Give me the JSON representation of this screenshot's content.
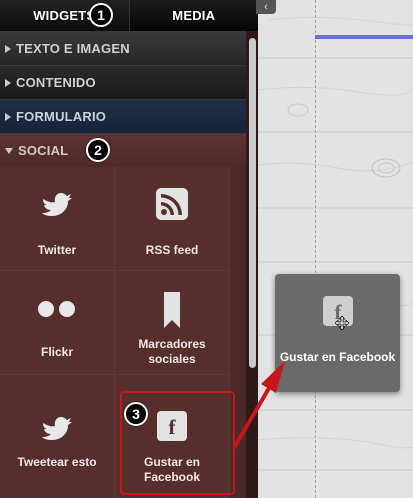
{
  "tabs": [
    {
      "label": "WIDGETS",
      "badge": "1"
    },
    {
      "label": "MEDIA"
    }
  ],
  "sections": [
    {
      "label": "TEXTO E IMAGEN"
    },
    {
      "label": "CONTENIDO"
    },
    {
      "label": "FORMULARIO"
    },
    {
      "label": "SOCIAL",
      "badge": "2"
    }
  ],
  "widgets": [
    {
      "label": "Twitter",
      "icon": "twitter-bird-icon"
    },
    {
      "label": "RSS feed",
      "icon": "rss-icon"
    },
    {
      "label": "Flickr",
      "icon": "flickr-icon"
    },
    {
      "label": "Marcadores sociales",
      "icon": "bookmark-icon"
    },
    {
      "label": "Tweetear esto",
      "icon": "twitter-bird-icon"
    },
    {
      "label": "Gustar en Facebook",
      "icon": "facebook-icon",
      "badge": "3"
    }
  ],
  "drag_card": {
    "label": "Gustar en Facebook",
    "icon": "facebook-icon"
  },
  "colors": {
    "highlight": "#c4161c",
    "sidebar": "#562f2d",
    "accent_line": "#6a6fd0"
  }
}
